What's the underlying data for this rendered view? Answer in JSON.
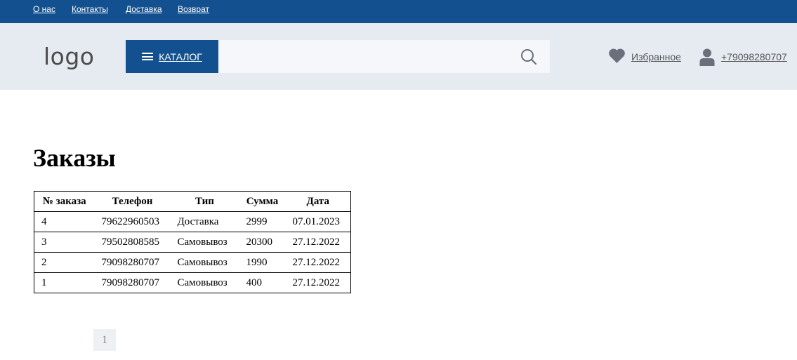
{
  "topnav": {
    "items": [
      "О нас",
      "Контакты",
      "Доставка",
      "Возврат"
    ]
  },
  "header": {
    "logo": "logo",
    "catalog_label": "КАТАЛОГ",
    "search_placeholder": "",
    "favorites_label": "Избранное",
    "phone": "+79098280707"
  },
  "main": {
    "title": "Заказы",
    "table": {
      "headers": [
        "№ заказа",
        "Телефон",
        "Тип",
        "Сумма",
        "Дата"
      ],
      "rows": [
        [
          "4",
          "79622960503",
          "Доставка",
          "2999",
          "07.01.2023"
        ],
        [
          "3",
          "79502808585",
          "Самовывоз",
          "20300",
          "27.12.2022"
        ],
        [
          "2",
          "79098280707",
          "Самовывоз",
          "1990",
          "27.12.2022"
        ],
        [
          "1",
          "79098280707",
          "Самовывоз",
          "400",
          "27.12.2022"
        ]
      ]
    },
    "pagination": {
      "current": "1"
    }
  },
  "colors": {
    "brand": "#13508f",
    "header_bg": "#e6ebf2",
    "icon": "#6b6f7b"
  },
  "icons": [
    "burger-menu-icon",
    "search-icon",
    "heart-icon",
    "user-icon"
  ]
}
